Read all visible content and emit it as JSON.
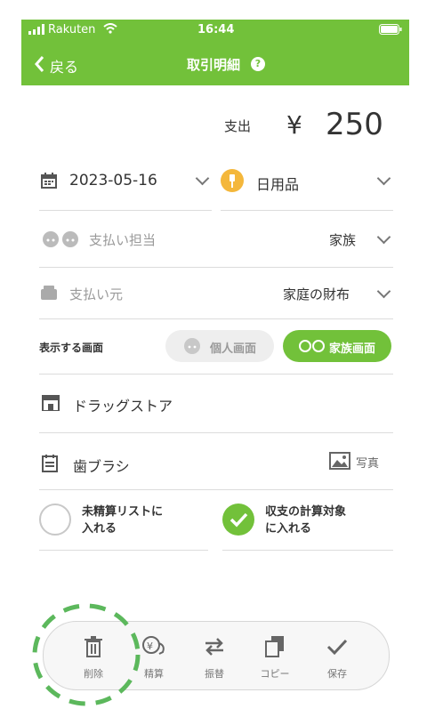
{
  "status": {
    "carrier": "Rakuten",
    "time": "16:44"
  },
  "nav": {
    "back_label": "戻る",
    "title": "取引明細"
  },
  "amount": {
    "type_label": "支出",
    "currency": "¥",
    "value": "250"
  },
  "date": {
    "value": "2023-05-16"
  },
  "category": {
    "value": "日用品"
  },
  "payer": {
    "label": "支払い担当",
    "value": "家族"
  },
  "source": {
    "label": "支払い元",
    "value": "家庭の財布"
  },
  "display": {
    "label": "表示する画面",
    "personal": "個人画面",
    "family": "家族画面"
  },
  "store": {
    "value": "ドラッグストア"
  },
  "memo": {
    "value": "歯ブラシ",
    "photo_label": "写真"
  },
  "options": {
    "unsettled": "未精算リストに\n入れる",
    "include_calc": "収支の計算対象\nに入れる"
  },
  "toolbar": {
    "delete": "削除",
    "settle": "精算",
    "transfer": "振替",
    "copy": "コピー",
    "save": "保存"
  },
  "colors": {
    "accent": "#72c13a",
    "category_badge": "#f4b73b"
  }
}
